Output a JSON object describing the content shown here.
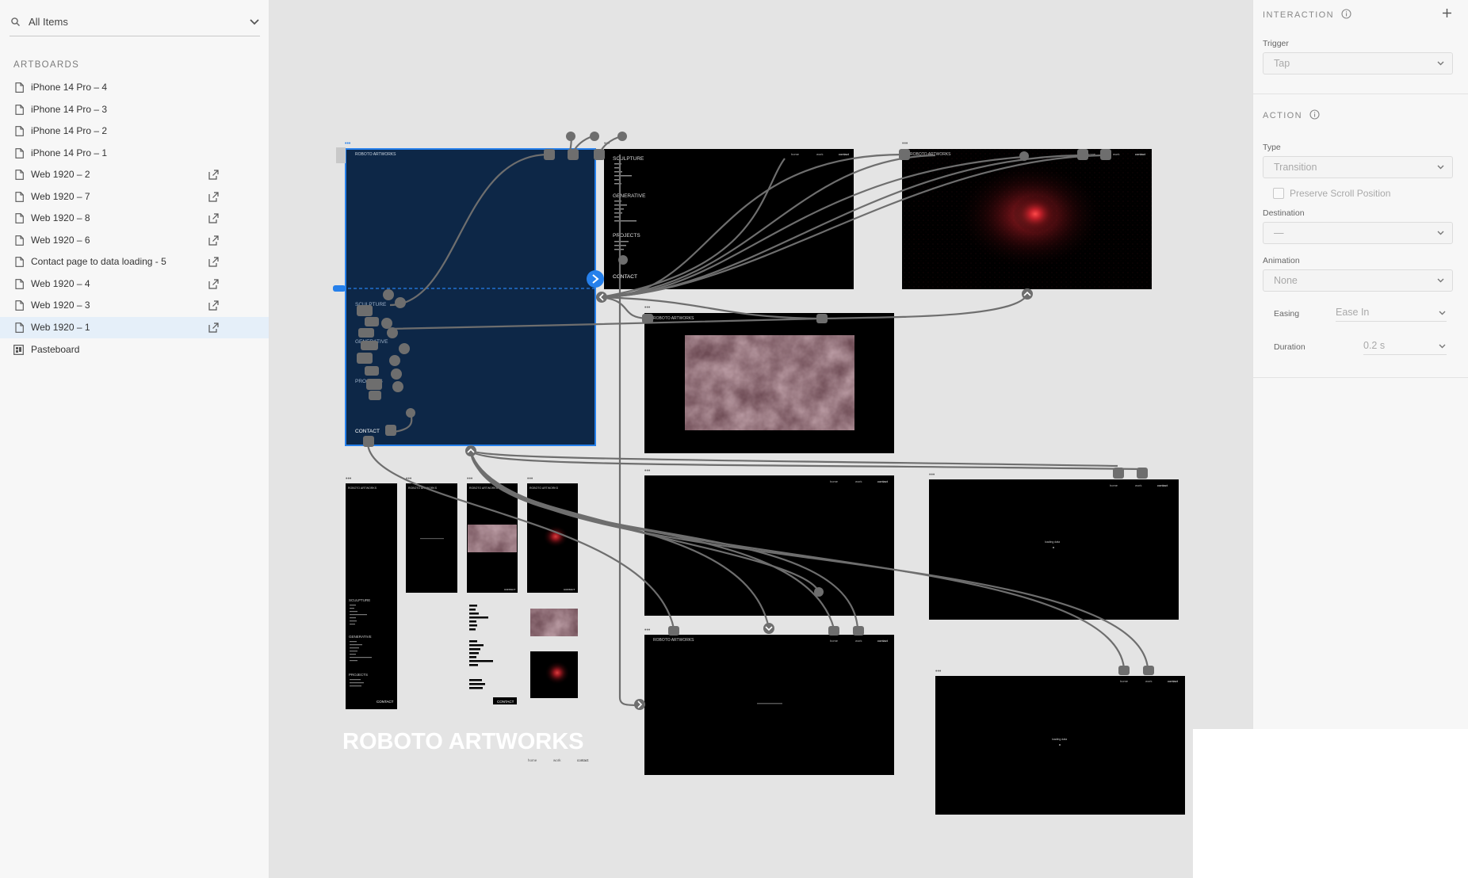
{
  "layers": {
    "search_label": "All Items",
    "section_label": "ARTBOARDS",
    "items": [
      {
        "label": "iPhone 14 Pro – 4",
        "external": false
      },
      {
        "label": "iPhone 14 Pro – 3",
        "external": false
      },
      {
        "label": "iPhone 14 Pro – 2",
        "external": false
      },
      {
        "label": "iPhone 14 Pro – 1",
        "external": false
      },
      {
        "label": "Web 1920 – 2",
        "external": true
      },
      {
        "label": "Web 1920 – 7",
        "external": true
      },
      {
        "label": "Web 1920 – 8",
        "external": true
      },
      {
        "label": "Web 1920 – 6",
        "external": true
      },
      {
        "label": "Contact page to data loading - 5",
        "external": true
      },
      {
        "label": "Web 1920 – 4",
        "external": true
      },
      {
        "label": "Web 1920 – 3",
        "external": true
      },
      {
        "label": "Web 1920 – 1",
        "external": true,
        "selected": true
      }
    ],
    "pasteboard_label": "Pasteboard"
  },
  "canvas": {
    "brand": "ROBOTO ARTWORKS",
    "brand_small": "ROBOTO ARTWORKS",
    "nav": [
      "home",
      "work",
      "contact"
    ],
    "menu": [
      "SCULPTURE",
      "GENERATIVE",
      "PROJECTS",
      "CONTACT"
    ],
    "loading_text": "loading data",
    "contact_button": "CONTACT"
  },
  "interaction": {
    "title": "INTERACTION",
    "trigger_label": "Trigger",
    "trigger_value": "Tap",
    "action_title": "ACTION",
    "type_label": "Type",
    "type_value": "Transition",
    "preserve_label": "Preserve Scroll Position",
    "preserve_checked": false,
    "destination_label": "Destination",
    "destination_value": "—",
    "animation_label": "Animation",
    "animation_value": "None",
    "easing_label": "Easing",
    "easing_value": "Ease In",
    "duration_label": "Duration",
    "duration_value": "0.2 s"
  },
  "colors": {
    "selection_blue": "#2680eb",
    "selected_artboard": "#0d2747",
    "wire": "#6e6e6e"
  }
}
